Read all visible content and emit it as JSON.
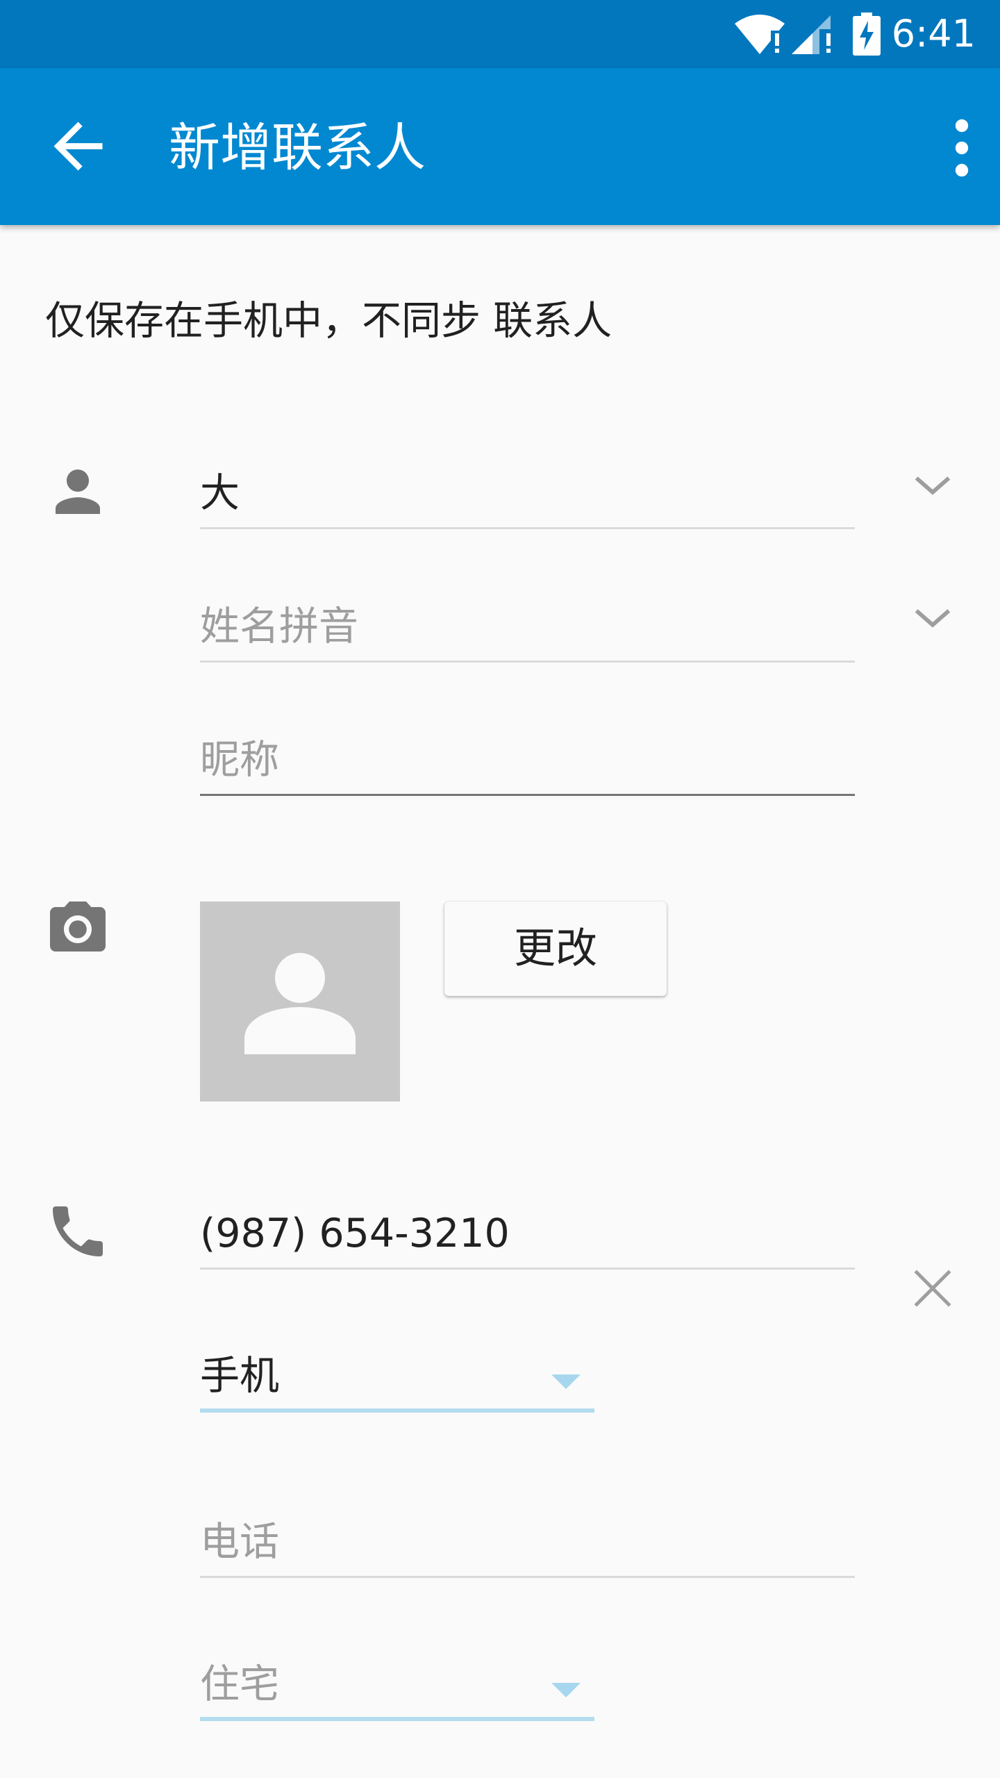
{
  "status_bar": {
    "time": "6:41",
    "icons": [
      "wifi-icon",
      "cell-signal-icon",
      "battery-charging-icon"
    ]
  },
  "app_bar": {
    "title": "新增联系人",
    "back_icon": "arrow-back-icon",
    "menu_icon": "more-vert-icon"
  },
  "notice": "仅保存在手机中，不同步 联系人",
  "name_section": {
    "icon": "person-icon",
    "name_value": "大",
    "phonetic_placeholder": "姓名拼音",
    "nickname_placeholder": "昵称"
  },
  "photo_section": {
    "icon": "camera-icon",
    "change_label": "更改"
  },
  "phone_section": {
    "icon": "phone-icon",
    "number_value": "(987) 654-3210",
    "type_value": "手机",
    "next_placeholder": "电话",
    "next_type_value": "住宅"
  },
  "colors": {
    "status_bar": "#0277bd",
    "app_bar": "#0288d1",
    "spinner_underline": "#b3dcef",
    "background": "#fafafa"
  }
}
